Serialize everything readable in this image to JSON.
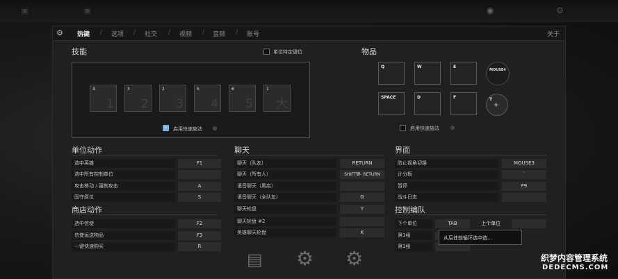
{
  "tabs": [
    {
      "label": "热键",
      "active": true
    },
    {
      "label": "选项"
    },
    {
      "label": "社交"
    },
    {
      "label": "视频"
    },
    {
      "label": "音频"
    },
    {
      "label": "账号"
    }
  ],
  "about_label": "关于",
  "skills": {
    "title": "技能",
    "unit_specific_label": "单位特定键位",
    "slots": [
      {
        "key": "4",
        "big": "1"
      },
      {
        "key": "3",
        "big": "2"
      },
      {
        "key": "2",
        "big": "3"
      },
      {
        "key": "5",
        "big": "4"
      },
      {
        "key": "6",
        "big": "5"
      },
      {
        "key": "1",
        "big": "大"
      }
    ],
    "quickcast_label": "启用快速施法"
  },
  "items": {
    "title": "物品",
    "slots": [
      {
        "key": "Q"
      },
      {
        "key": "W"
      },
      {
        "key": "E"
      },
      {
        "key": "SPACE"
      },
      {
        "key": "D"
      },
      {
        "key": "F"
      }
    ],
    "mouse4": "MOUSE4",
    "tp_key": "T",
    "quickcast_label": "启用快速施法"
  },
  "unit_actions": {
    "title": "单位动作",
    "rows": [
      {
        "label": "选中英雄",
        "key": "F1"
      },
      {
        "label": "选中所有控制单位",
        "key": ""
      },
      {
        "label": "攻击移动 / 强制攻击",
        "key": "A"
      },
      {
        "label": "固守原位",
        "key": "S"
      }
    ]
  },
  "shop_actions": {
    "title": "商店动作",
    "rows": [
      {
        "label": "选中信使",
        "key": "F2"
      },
      {
        "label": "信使运送物品",
        "key": "F3"
      },
      {
        "label": "一键快速购买",
        "key": "R"
      }
    ]
  },
  "chat": {
    "title": "聊天",
    "rows": [
      {
        "label": "聊天（队友）",
        "key": "RETURN"
      },
      {
        "label": "聊天（所有人）",
        "key": "SHIFT键- RETURN"
      },
      {
        "label": "语音聊天（黑店）",
        "key": ""
      },
      {
        "label": "语音聊天（全队友）",
        "key": "G"
      },
      {
        "label": "聊天轮盘",
        "key": "Y"
      },
      {
        "label": "聊天轮盘 #2",
        "key": ""
      },
      {
        "label": "英雄聊天轮盘",
        "key": "K"
      }
    ]
  },
  "interface": {
    "title": "界面",
    "rows": [
      {
        "label": "防止视角切换",
        "key": "MOUSE3"
      },
      {
        "label": "计分板",
        "key": "`"
      },
      {
        "label": "暂停",
        "key": "F9"
      },
      {
        "label": "战斗日志",
        "key": ""
      }
    ]
  },
  "control_groups": {
    "title": "控制编队",
    "rows": [
      {
        "label": "下个单位",
        "key": "TAB",
        "key2": "上个单位",
        "key3": ""
      },
      {
        "label": "第1组",
        "key": "",
        "key2": "",
        "key3": ""
      },
      {
        "label": "第3组",
        "key": "",
        "key2": "",
        "key3": ""
      }
    ],
    "tooltip": "从后往前循环选中选..."
  },
  "watermark": {
    "line1": "织梦内容管理系统",
    "line2": "DEDECMS.COM"
  },
  "colors": {
    "panel": "#1f2021",
    "accent": "#d6d6d6",
    "quickcast_icon": "#7fb2d6"
  }
}
